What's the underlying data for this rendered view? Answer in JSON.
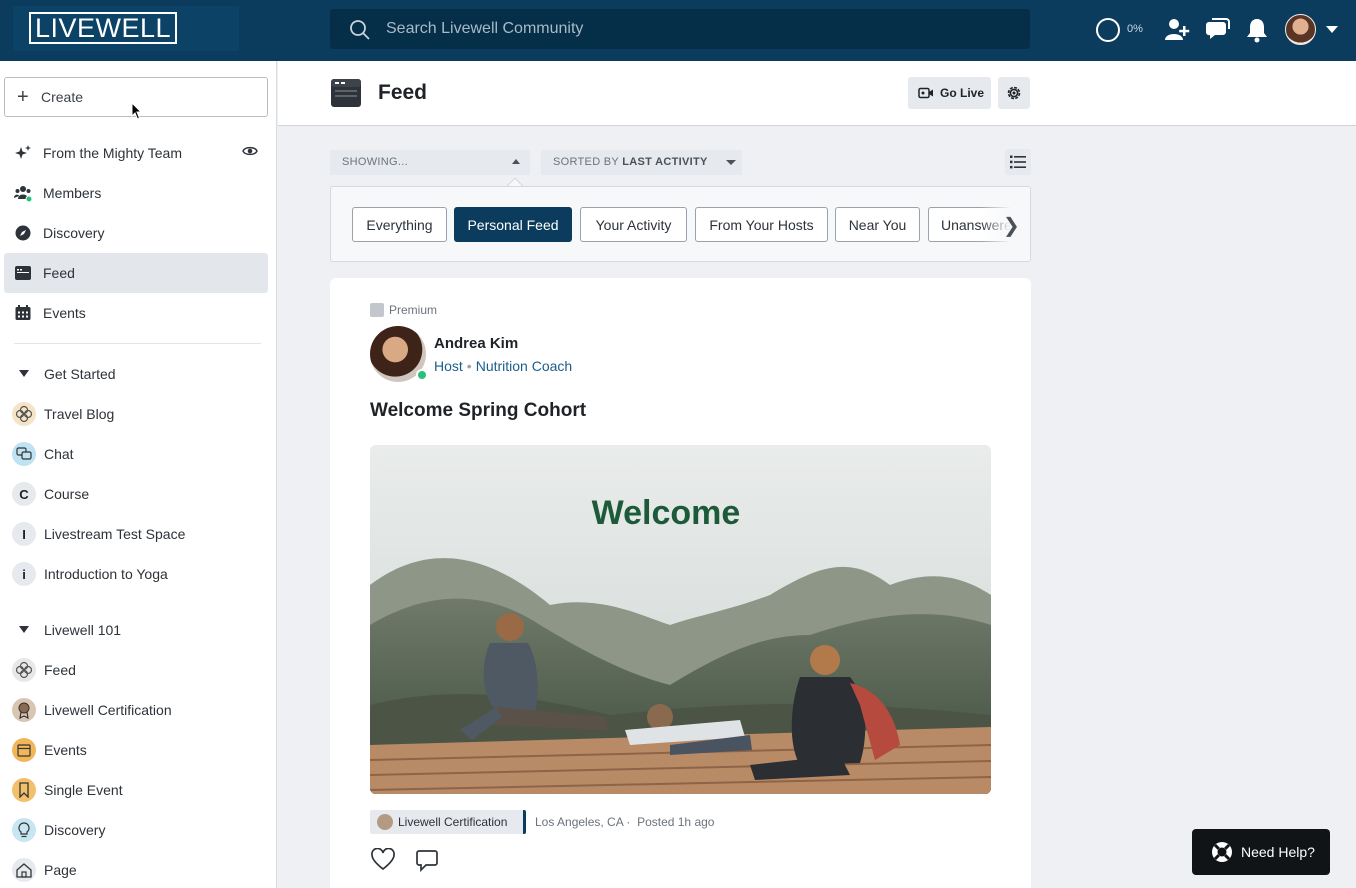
{
  "brand": {
    "logo_text": "LIVEWELL"
  },
  "topbar": {
    "search_placeholder": "Search Livewell Community",
    "progress": "0%"
  },
  "sidebar": {
    "create_label": "Create",
    "nav": [
      {
        "label": "From the Mighty Team"
      },
      {
        "label": "Members"
      },
      {
        "label": "Discovery"
      },
      {
        "label": "Feed"
      },
      {
        "label": "Events"
      }
    ],
    "group1": {
      "title": "Get Started",
      "spaces": [
        {
          "label": "Travel Blog"
        },
        {
          "label": "Chat"
        },
        {
          "label": "Course",
          "letter": "C"
        },
        {
          "label": "Livestream Test Space",
          "letter": "I"
        },
        {
          "label": "Introduction to Yoga",
          "letter": "i"
        }
      ]
    },
    "group2": {
      "title": "Livewell 101",
      "spaces": [
        {
          "label": "Feed"
        },
        {
          "label": "Livewell Certification"
        },
        {
          "label": "Events"
        },
        {
          "label": "Single Event"
        },
        {
          "label": "Discovery"
        },
        {
          "label": "Page"
        }
      ]
    }
  },
  "header": {
    "title": "Feed",
    "go_live": "Go Live"
  },
  "filters": {
    "showing": "SHOWING...",
    "sorted_prefix": "SORTED BY",
    "sorted_value": "LAST ACTIVITY"
  },
  "tabs": [
    {
      "label": "Everything"
    },
    {
      "label": "Personal Feed"
    },
    {
      "label": "Your Activity"
    },
    {
      "label": "From Your Hosts"
    },
    {
      "label": "Near You"
    },
    {
      "label": "Unanswered"
    }
  ],
  "post": {
    "badge": "Premium",
    "author": "Andrea Kim",
    "role": "Host",
    "subtitle": "Nutrition Coach",
    "title": "Welcome Spring Cohort",
    "image_text": "Welcome",
    "space": "Livewell Certification",
    "location": "Los Angeles, CA",
    "posted": "Posted 1h ago"
  },
  "help": {
    "label": "Need Help?"
  },
  "colors": {
    "brand": "#0b3c5d",
    "accent_online": "#29c07a"
  }
}
